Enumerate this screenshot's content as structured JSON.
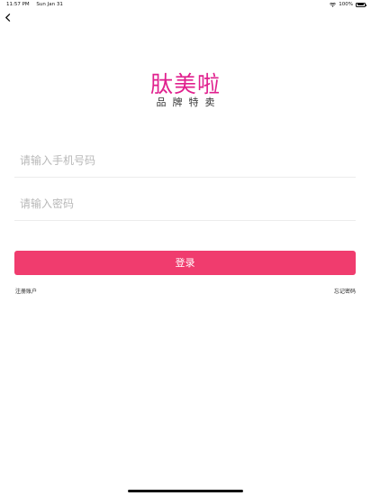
{
  "status_bar": {
    "time": "11:57 PM",
    "date": "Sun Jan 31",
    "battery": "100%",
    "icons": [
      "wifi-icon",
      "battery-icon"
    ]
  },
  "nav": {
    "back_icon": "chevron-left-icon"
  },
  "logo": {
    "brand": "肽美啦",
    "tagline": "品牌特卖",
    "color": "#e0208e"
  },
  "login_form": {
    "phone_placeholder": "请输入手机号码",
    "phone_value": "",
    "password_placeholder": "请输入密码",
    "password_value": "",
    "submit_label": "登录",
    "submit_color": "#f03c6e"
  },
  "links": {
    "register": "注册账户",
    "forgot_password": "忘记密码"
  }
}
